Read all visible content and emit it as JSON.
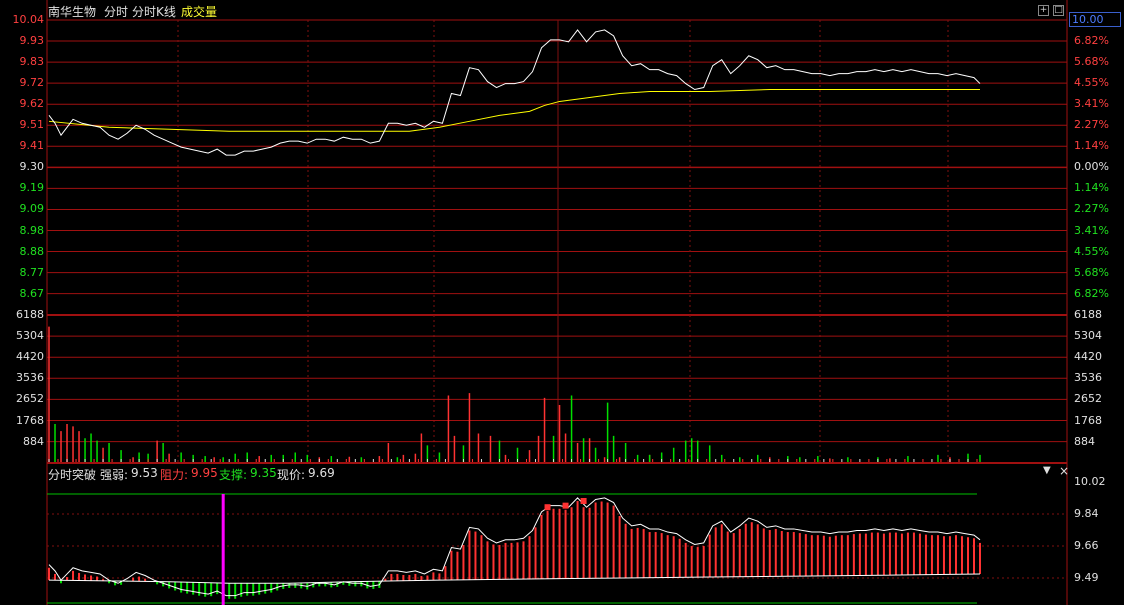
{
  "header": {
    "stock_name": "南华生物",
    "tab_intraday": "分时",
    "tab_kline": "分时K线",
    "tab_volume": "成交量"
  },
  "price_box": "10.00",
  "top_icons": [
    "+",
    "□"
  ],
  "indicator": {
    "name": "分时突破",
    "strength_label": "强弱:",
    "strength_value": "9.53",
    "resistance_label": "阻力:",
    "resistance_value": "9.95",
    "support_label": "支撑:",
    "support_value": "9.35",
    "current_label": "现价:",
    "current_value": "9.69",
    "axis_labels": [
      "10.02",
      "9.84",
      "9.66",
      "9.49"
    ]
  },
  "colors": {
    "up": "#ff3232",
    "down": "#00e000",
    "price_line": "#ffffff",
    "avg_line": "#ffff00",
    "grid": "#a01010",
    "support_line": "#00c000",
    "marker_line": "#ff00ff"
  },
  "chart_data": [
    {
      "type": "line",
      "name": "price-panel",
      "prev_close": 9.3,
      "y_ticks_left": [
        "10.04",
        "9.93",
        "9.83",
        "9.72",
        "9.62",
        "9.51",
        "9.41",
        "9.30",
        "9.19",
        "9.09",
        "8.98",
        "8.88",
        "8.77",
        "8.67"
      ],
      "y_ticks_right": [
        "6.82%",
        "5.68%",
        "4.55%",
        "3.41%",
        "2.27%",
        "1.14%",
        "0.00%",
        "1.14%",
        "2.27%",
        "3.41%",
        "4.55%",
        "5.68%",
        "6.82%"
      ],
      "ylim": [
        8.56,
        10.04
      ],
      "series": [
        {
          "points": [
            [
              0,
              9.56
            ],
            [
              2,
              9.52
            ],
            [
              4,
              9.46
            ],
            [
              6,
              9.5
            ],
            [
              8,
              9.54
            ],
            [
              11,
              9.52
            ],
            [
              14,
              9.51
            ],
            [
              17,
              9.5
            ],
            [
              20,
              9.46
            ],
            [
              23,
              9.44
            ],
            [
              26,
              9.47
            ],
            [
              29,
              9.51
            ],
            [
              32,
              9.49
            ],
            [
              35,
              9.46
            ],
            [
              38,
              9.44
            ],
            [
              41,
              9.42
            ],
            [
              44,
              9.4
            ],
            [
              47,
              9.39
            ],
            [
              50,
              9.38
            ],
            [
              53,
              9.37
            ],
            [
              56,
              9.39
            ],
            [
              59,
              9.36
            ],
            [
              62,
              9.36
            ],
            [
              65,
              9.38
            ],
            [
              68,
              9.38
            ],
            [
              71,
              9.39
            ],
            [
              74,
              9.4
            ],
            [
              77,
              9.42
            ],
            [
              80,
              9.43
            ],
            [
              83,
              9.43
            ],
            [
              86,
              9.42
            ],
            [
              89,
              9.44
            ],
            [
              92,
              9.44
            ],
            [
              95,
              9.43
            ],
            [
              98,
              9.45
            ],
            [
              101,
              9.44
            ],
            [
              104,
              9.44
            ],
            [
              107,
              9.42
            ],
            [
              110,
              9.43
            ],
            [
              113,
              9.52
            ],
            [
              116,
              9.52
            ],
            [
              119,
              9.51
            ],
            [
              122,
              9.52
            ],
            [
              125,
              9.5
            ],
            [
              128,
              9.53
            ],
            [
              131,
              9.52
            ],
            [
              134,
              9.67
            ],
            [
              137,
              9.66
            ],
            [
              140,
              9.8
            ],
            [
              143,
              9.79
            ],
            [
              146,
              9.73
            ],
            [
              149,
              9.7
            ],
            [
              152,
              9.72
            ],
            [
              155,
              9.72
            ],
            [
              158,
              9.73
            ],
            [
              161,
              9.78
            ],
            [
              164,
              9.9
            ],
            [
              167,
              9.94
            ],
            [
              170,
              9.94
            ],
            [
              173,
              9.93
            ],
            [
              176,
              9.99
            ],
            [
              179,
              9.93
            ],
            [
              182,
              9.98
            ],
            [
              185,
              9.99
            ],
            [
              188,
              9.96
            ],
            [
              191,
              9.86
            ],
            [
              194,
              9.81
            ],
            [
              197,
              9.82
            ],
            [
              200,
              9.79
            ],
            [
              203,
              9.79
            ],
            [
              206,
              9.77
            ],
            [
              209,
              9.76
            ],
            [
              212,
              9.72
            ],
            [
              215,
              9.69
            ],
            [
              218,
              9.7
            ],
            [
              221,
              9.81
            ],
            [
              224,
              9.84
            ],
            [
              227,
              9.77
            ],
            [
              230,
              9.81
            ],
            [
              233,
              9.86
            ],
            [
              236,
              9.84
            ],
            [
              239,
              9.8
            ],
            [
              242,
              9.81
            ],
            [
              245,
              9.79
            ],
            [
              248,
              9.79
            ],
            [
              251,
              9.78
            ],
            [
              254,
              9.77
            ],
            [
              257,
              9.77
            ],
            [
              260,
              9.76
            ],
            [
              263,
              9.77
            ],
            [
              266,
              9.77
            ],
            [
              269,
              9.78
            ],
            [
              272,
              9.78
            ],
            [
              275,
              9.79
            ],
            [
              278,
              9.78
            ],
            [
              281,
              9.79
            ],
            [
              284,
              9.78
            ],
            [
              287,
              9.79
            ],
            [
              290,
              9.78
            ],
            [
              293,
              9.77
            ],
            [
              296,
              9.77
            ],
            [
              299,
              9.76
            ],
            [
              302,
              9.77
            ],
            [
              305,
              9.76
            ],
            [
              308,
              9.75
            ],
            [
              310,
              9.72
            ]
          ]
        },
        {
          "points": [
            [
              0,
              9.53
            ],
            [
              20,
              9.5
            ],
            [
              40,
              9.49
            ],
            [
              60,
              9.48
            ],
            [
              80,
              9.48
            ],
            [
              100,
              9.48
            ],
            [
              120,
              9.48
            ],
            [
              130,
              9.5
            ],
            [
              140,
              9.53
            ],
            [
              150,
              9.56
            ],
            [
              160,
              9.58
            ],
            [
              165,
              9.61
            ],
            [
              170,
              9.63
            ],
            [
              175,
              9.64
            ],
            [
              180,
              9.65
            ],
            [
              190,
              9.67
            ],
            [
              200,
              9.68
            ],
            [
              220,
              9.68
            ],
            [
              240,
              9.69
            ],
            [
              260,
              9.69
            ],
            [
              280,
              9.69
            ],
            [
              300,
              9.69
            ],
            [
              310,
              9.69
            ]
          ]
        }
      ]
    },
    {
      "type": "bar",
      "name": "volume-panel",
      "y_ticks": [
        "6188",
        "5304",
        "4420",
        "3536",
        "2652",
        "1768",
        "884"
      ],
      "ylim": [
        0,
        6188
      ],
      "up_bars": [
        [
          0,
          5700
        ],
        [
          4,
          1300
        ],
        [
          6,
          1600
        ],
        [
          8,
          1500
        ],
        [
          10,
          1300
        ],
        [
          18,
          600
        ],
        [
          28,
          200
        ],
        [
          36,
          900
        ],
        [
          40,
          350
        ],
        [
          55,
          200
        ],
        [
          70,
          250
        ],
        [
          90,
          200
        ],
        [
          100,
          220
        ],
        [
          110,
          250
        ],
        [
          113,
          800
        ],
        [
          118,
          300
        ],
        [
          122,
          350
        ],
        [
          124,
          1200
        ],
        [
          133,
          2800
        ],
        [
          135,
          1100
        ],
        [
          140,
          2900
        ],
        [
          143,
          1200
        ],
        [
          147,
          1100
        ],
        [
          152,
          300
        ],
        [
          160,
          500
        ],
        [
          163,
          1100
        ],
        [
          165,
          2700
        ],
        [
          170,
          2400
        ],
        [
          172,
          1200
        ],
        [
          176,
          800
        ],
        [
          180,
          1000
        ],
        [
          185,
          200
        ],
        [
          190,
          200
        ],
        [
          200,
          300
        ],
        [
          220,
          200
        ],
        [
          240,
          200
        ],
        [
          260,
          150
        ],
        [
          280,
          150
        ],
        [
          300,
          200
        ]
      ],
      "down_bars": [
        [
          2,
          1600
        ],
        [
          12,
          1000
        ],
        [
          14,
          1200
        ],
        [
          16,
          900
        ],
        [
          20,
          800
        ],
        [
          24,
          500
        ],
        [
          30,
          400
        ],
        [
          33,
          350
        ],
        [
          38,
          800
        ],
        [
          44,
          400
        ],
        [
          48,
          300
        ],
        [
          52,
          250
        ],
        [
          58,
          200
        ],
        [
          62,
          350
        ],
        [
          66,
          400
        ],
        [
          74,
          300
        ],
        [
          78,
          300
        ],
        [
          82,
          400
        ],
        [
          86,
          300
        ],
        [
          94,
          250
        ],
        [
          104,
          200
        ],
        [
          116,
          200
        ],
        [
          126,
          700
        ],
        [
          130,
          400
        ],
        [
          138,
          700
        ],
        [
          150,
          900
        ],
        [
          156,
          600
        ],
        [
          168,
          1100
        ],
        [
          174,
          2800
        ],
        [
          178,
          1000
        ],
        [
          182,
          600
        ],
        [
          186,
          2500
        ],
        [
          188,
          1100
        ],
        [
          192,
          800
        ],
        [
          196,
          300
        ],
        [
          200,
          300
        ],
        [
          204,
          400
        ],
        [
          208,
          600
        ],
        [
          212,
          900
        ],
        [
          214,
          1000
        ],
        [
          216,
          900
        ],
        [
          220,
          700
        ],
        [
          224,
          300
        ],
        [
          230,
          200
        ],
        [
          236,
          300
        ],
        [
          246,
          250
        ],
        [
          250,
          200
        ],
        [
          256,
          250
        ],
        [
          266,
          200
        ],
        [
          276,
          200
        ],
        [
          286,
          250
        ],
        [
          296,
          300
        ],
        [
          306,
          350
        ],
        [
          310,
          300
        ]
      ]
    },
    {
      "type": "bar",
      "name": "breakout-indicator",
      "ylim": [
        9.38,
        10.1
      ],
      "resistance": 9.95,
      "support": 9.35,
      "marker_index": 58,
      "strength_line": [
        [
          0,
          9.51
        ],
        [
          40,
          9.5
        ],
        [
          60,
          9.49
        ],
        [
          80,
          9.49
        ],
        [
          100,
          9.5
        ],
        [
          130,
          9.51
        ],
        [
          170,
          9.52
        ],
        [
          220,
          9.53
        ],
        [
          270,
          9.54
        ],
        [
          310,
          9.55
        ]
      ],
      "signal_points": [
        [
          166,
          9.93
        ],
        [
          172,
          9.94
        ],
        [
          178,
          9.97
        ]
      ]
    }
  ]
}
